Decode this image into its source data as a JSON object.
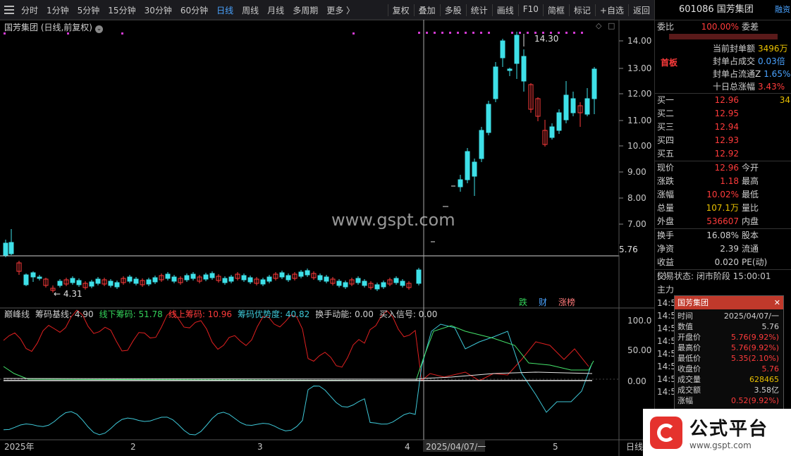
{
  "toolbar": {
    "periods": [
      "分时",
      "1分钟",
      "5分钟",
      "15分钟",
      "30分钟",
      "60分钟",
      "日线",
      "周线",
      "月线",
      "多周期",
      "更多 〉"
    ],
    "active": "日线",
    "actions": [
      "复权",
      "叠加",
      "多股",
      "统计",
      "画线",
      "F10",
      "简框",
      "标记",
      "+自选",
      "返回"
    ]
  },
  "chart": {
    "title": "国芳集团 (日线,前复权)",
    "y_ticks": [
      "14.00",
      "13.00",
      "12.00",
      "11.00",
      "10.00",
      "9.00",
      "8.00",
      "7.00"
    ],
    "current_price_label": "5.76",
    "high_marker": "14.30",
    "low_marker": "4.31",
    "event_labels": [
      "跌",
      "财",
      "涨榜"
    ],
    "x_labels": [
      "2025年",
      "2",
      "3",
      "4",
      "2025/04/07/一",
      "5",
      "日线"
    ]
  },
  "indicator": {
    "name": "巅峰线",
    "items": [
      {
        "label": "筹码基线: 4.90",
        "color": "#d0d0d0"
      },
      {
        "label": "线下筹码: 51.78",
        "color": "#34d35a"
      },
      {
        "label": "线上筹码: 10.96",
        "color": "#ff3b3b"
      },
      {
        "label": "筹码优势度: 40.82",
        "color": "#3ec8d8"
      },
      {
        "label": "换手动能: 0.00",
        "color": "#d0d0d0"
      },
      {
        "label": "买入信号: 0.00",
        "color": "#d0d0d0"
      }
    ],
    "y_ticks": [
      "100.0",
      "50.00",
      "0.00"
    ]
  },
  "watermark": "www.gspt.com",
  "right": {
    "code": "601086",
    "name": "国芳集团",
    "corner": "融资",
    "webi_label": "委比",
    "webi_value": "100.00%",
    "weicha_label": "委差",
    "board": "首板",
    "seal_rows": [
      {
        "label": "当前封单额",
        "value": "3496万"
      },
      {
        "label": "封单占成交",
        "value": "0.03倍"
      },
      {
        "label": "封单占流通Z",
        "value": "1.65%"
      },
      {
        "label": "十日总涨幅",
        "value": "3.43%"
      }
    ],
    "bids": [
      {
        "label": "买一",
        "price": "12.96",
        "vol": "34"
      },
      {
        "label": "买二",
        "price": "12.95",
        "vol": ""
      },
      {
        "label": "买三",
        "price": "12.94",
        "vol": ""
      },
      {
        "label": "买四",
        "price": "12.93",
        "vol": ""
      },
      {
        "label": "买五",
        "price": "12.92",
        "vol": ""
      }
    ],
    "quote": [
      {
        "l1": "现价",
        "v1": "12.96",
        "l2": "今开"
      },
      {
        "l1": "涨跌",
        "v1": "1.18",
        "l2": "最高"
      },
      {
        "l1": "涨幅",
        "v1": "10.02%",
        "l2": "最低"
      },
      {
        "l1": "总量",
        "v1": "107.1万",
        "l2": "量比"
      },
      {
        "l1": "外盘",
        "v1": "536607",
        "l2": "内盘"
      }
    ],
    "fund": [
      {
        "l1": "换手",
        "v1": "16.08%",
        "l2": "股本"
      },
      {
        "l1": "净资",
        "v1": "2.39",
        "l2": "流通"
      },
      {
        "l1": "收益(-)",
        "v1": "0.020",
        "l2": "PE(动)"
      }
    ],
    "trade_status": "交易状态: 闭市阶段 15:00:01",
    "main_label": "主力",
    "ticks": [
      "14:5",
      "14:5",
      "14:5",
      "14:5",
      "14:5",
      "14:5",
      "14:5",
      "14:5"
    ]
  },
  "popup": {
    "title": "国芳集团",
    "rows": [
      {
        "k": "时间",
        "v": "2025/04/07/一"
      },
      {
        "k": "数值",
        "v": "5.76"
      },
      {
        "k": "开盘价",
        "v": "5.76(9.92%)"
      },
      {
        "k": "最高价",
        "v": "5.76(9.92%)"
      },
      {
        "k": "最低价",
        "v": "5.35(2.10%)"
      },
      {
        "k": "收盘价",
        "v": "5.76"
      },
      {
        "k": "成交量",
        "v": "628465"
      },
      {
        "k": "成交额",
        "v": "3.58亿"
      },
      {
        "k": "涨幅",
        "v": "0.52(9.92%)"
      }
    ]
  },
  "logo": {
    "text": "公式平台",
    "url": "www.gspt.com"
  }
}
